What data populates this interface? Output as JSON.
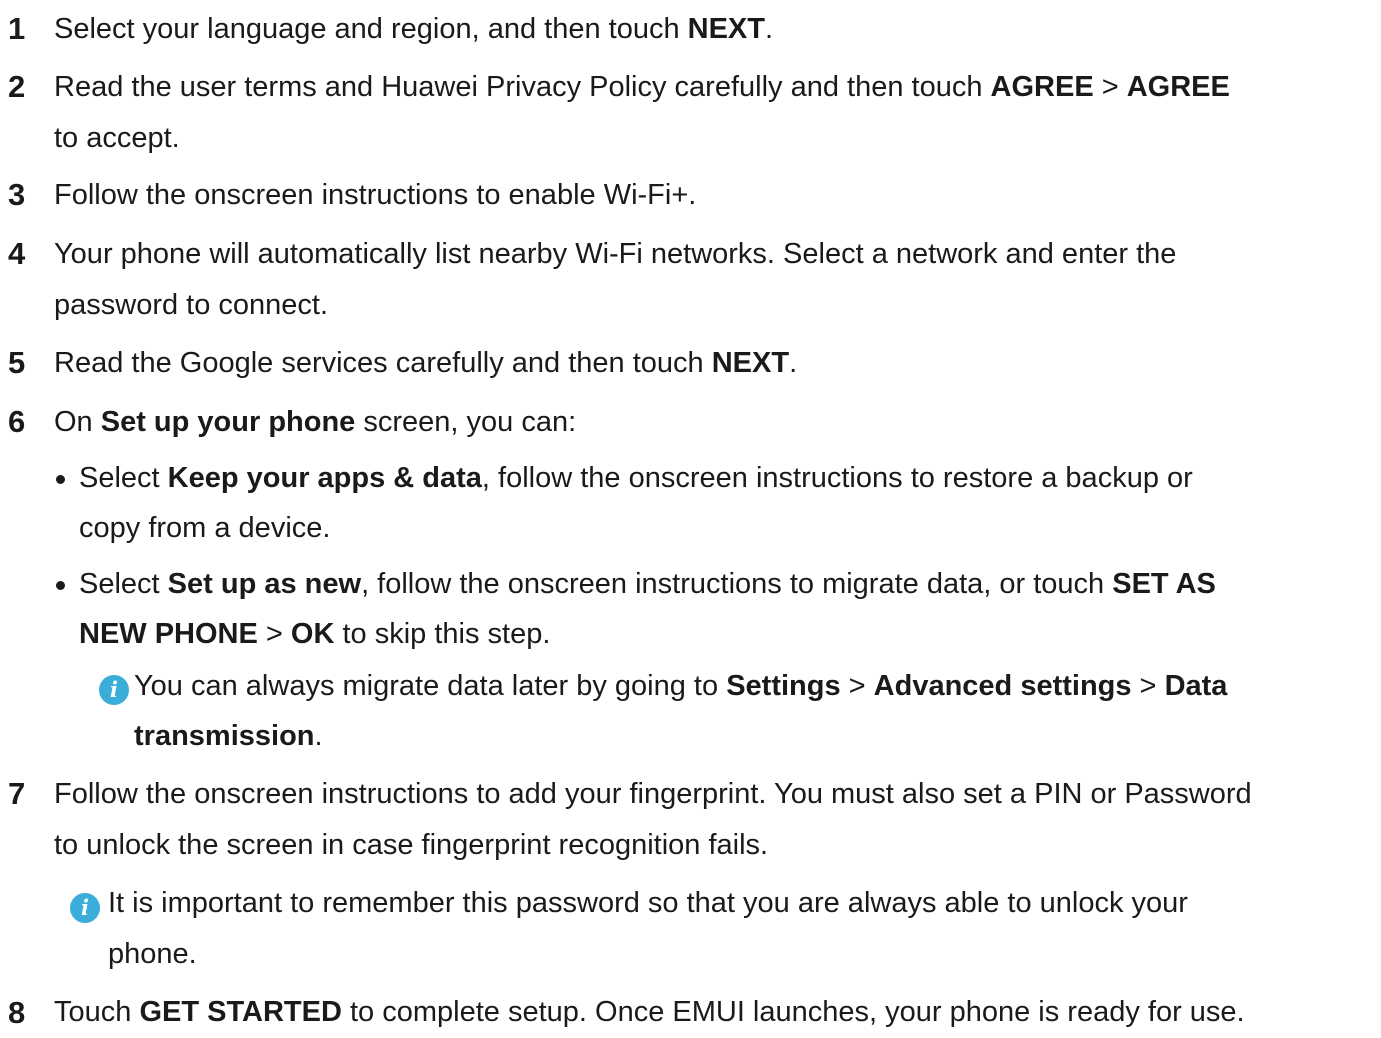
{
  "steps": [
    {
      "number": "1",
      "lines": [
        [
          "Select your language and region, and then touch ",
          "NEXT",
          "."
        ]
      ]
    },
    {
      "number": "2",
      "lines": [
        [
          "Read the user terms and Huawei Privacy Policy carefully and then touch ",
          "AGREE",
          " > ",
          "AGREE"
        ],
        [
          "to accept."
        ]
      ]
    },
    {
      "number": "3",
      "lines": [
        [
          "Follow the onscreen instructions to enable Wi-Fi+."
        ]
      ]
    },
    {
      "number": "4",
      "lines": [
        [
          "Your phone will automatically list nearby Wi-Fi networks. Select a network and enter the"
        ],
        [
          "password to connect."
        ]
      ]
    },
    {
      "number": "5",
      "lines": [
        [
          "Read the Google services carefully and then touch ",
          "NEXT",
          "."
        ]
      ]
    },
    {
      "number": "6",
      "lines": [
        [
          "On ",
          "Set up your phone",
          " screen, you can:"
        ]
      ]
    },
    {
      "number": "7",
      "lines": [
        [
          "Follow the onscreen instructions to add your fingerprint. You must also set a PIN or Password"
        ],
        [
          "to unlock the screen in case fingerprint recognition fails."
        ]
      ]
    },
    {
      "number": "8",
      "lines": [
        [
          "Touch ",
          "GET STARTED",
          " to complete setup. Once EMUI launches, your phone is ready for use."
        ]
      ]
    }
  ],
  "bullets": [
    {
      "lines": [
        [
          "Select ",
          "Keep your apps & data",
          ", follow the onscreen instructions to restore a backup or"
        ],
        [
          "copy from a device."
        ]
      ]
    },
    {
      "lines": [
        [
          "Select ",
          "Set up as new",
          ", follow the onscreen instructions to migrate data, or touch ",
          "SET AS"
        ],
        [
          "NEW PHONE",
          " > ",
          "OK",
          " to skip this step."
        ]
      ]
    }
  ],
  "notes": [
    {
      "icon": "info-icon",
      "lines": [
        [
          "You can always migrate data later by going to ",
          "Settings",
          " > ",
          "Advanced settings",
          " > ",
          "Data"
        ],
        [
          "transmission",
          "."
        ]
      ]
    },
    {
      "icon": "info-icon",
      "lines": [
        [
          "It is important to remember this password so that you are always able to unlock your"
        ],
        [
          "phone."
        ]
      ]
    }
  ]
}
